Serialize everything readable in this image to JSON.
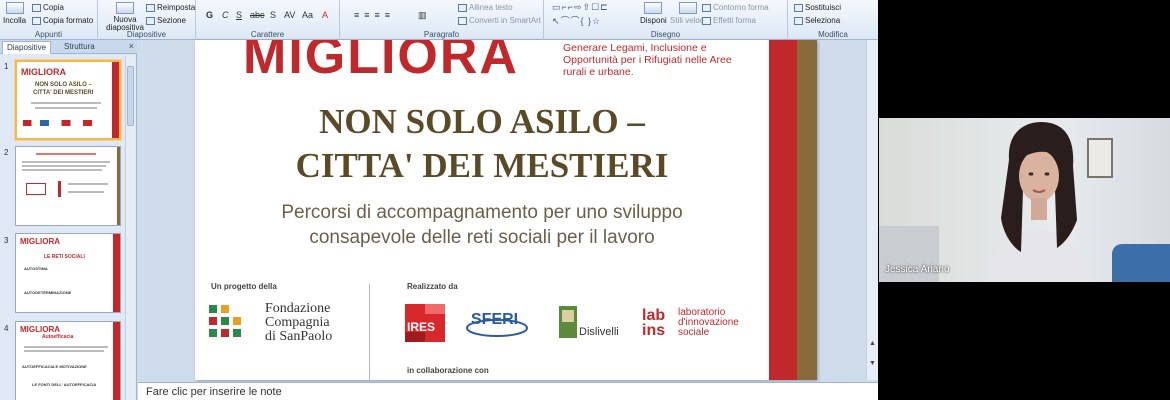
{
  "ribbon": {
    "groups": [
      {
        "label": "Appunti",
        "buttons": [
          "Incolla",
          "Copia",
          "Copia formato"
        ]
      },
      {
        "label": "Diapositive",
        "buttons": [
          "Nuova diapositiva",
          "Reimposta",
          "Sezione"
        ]
      },
      {
        "label": "Carattere",
        "buttons": [
          "G",
          "C",
          "S",
          "abc",
          "S",
          "AV",
          "Aa",
          "A"
        ]
      },
      {
        "label": "Paragrafo",
        "buttons": [
          "Allinea testo",
          "Converti in SmartArt"
        ]
      },
      {
        "label": "Disegno",
        "buttons": [
          "Disponi",
          "Stili veloci",
          "Contorno forma",
          "Effetti forma"
        ]
      },
      {
        "label": "Modifica",
        "buttons": [
          "Sostituisci",
          "Seleziona"
        ]
      }
    ]
  },
  "leftpane": {
    "tabs": [
      "Diapositive",
      "Struttura"
    ],
    "close": "×",
    "thumbnails": [
      {
        "number": "1",
        "title": "MIGLIORA",
        "lines": [
          "NON SOLO ASILO –",
          "CITTA' DEI MESTIERI"
        ]
      },
      {
        "number": "2",
        "title": "",
        "lines": []
      },
      {
        "number": "3",
        "title": "MIGLIORA",
        "lines": [
          "LE RETI SOCIALI",
          "AUTOSTIMA",
          "AUTODETERMINAZIONE"
        ]
      },
      {
        "number": "4",
        "title": "MIGLIORA",
        "lines": [
          "Autoefficacia",
          "AUTOEFFICACIA E MOTIVAZIONE",
          "LE FONTI DELL' AUTOEFFICACIA"
        ]
      }
    ]
  },
  "slide": {
    "logo": "MIGLIORA",
    "tagline": "Generare Legami, Inclusione e Opportunità per i Rifugiati nelle Aree rurali e urbane.",
    "title_line1": "NON SOLO ASILO –",
    "title_line2": "CITTA' DEI MESTIERI",
    "subtitle_line1": "Percorsi di accompagnamento per uno sviluppo",
    "subtitle_line2": "consapevole delle reti sociali per il lavoro",
    "project_by": "Un progetto della",
    "made_by": "Realizzato da",
    "in_collab": "in collaborazione con",
    "fondazione": [
      "Fondazione",
      "Compagnia",
      "di SanPaolo"
    ],
    "partners": {
      "ires": "IRES",
      "sferi": "SFERI",
      "dislivelli": "Dislivelli",
      "lab_mark": [
        "lab",
        "ins"
      ],
      "lab_text": [
        "laboratorio",
        "d'innovazione",
        "sociale"
      ]
    },
    "colors": {
      "accent_red": "#c0282b",
      "title_brown": "#5a4a26"
    }
  },
  "notes": {
    "placeholder": "Fare clic per inserire le note"
  },
  "webcam": {
    "participant_name": "Jessica Ariano"
  }
}
